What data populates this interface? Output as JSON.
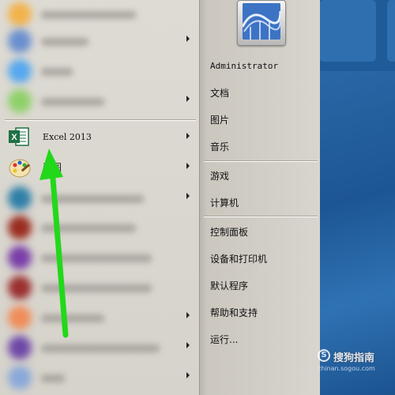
{
  "start_menu": {
    "programs": [
      {
        "label": "",
        "blurred": true,
        "color": "#f2b24a",
        "has_arrow": false
      },
      {
        "label": "",
        "blurred": true,
        "color": "#6a8fcf",
        "has_arrow": true
      },
      {
        "label": "",
        "blurred": true,
        "color": "#56a8f0",
        "has_arrow": false
      },
      {
        "label": "",
        "blurred": true,
        "color": "#8fd068",
        "has_arrow": true
      },
      {
        "label": "Excel 2013",
        "blurred": false,
        "icon": "excel-icon",
        "has_arrow": true
      },
      {
        "label": "画图",
        "blurred": false,
        "icon": "paint-icon",
        "has_arrow": true
      },
      {
        "label": "",
        "blurred": true,
        "color": "#2f7fa8",
        "has_arrow": true
      },
      {
        "label": "",
        "blurred": true,
        "color": "#9a2c20",
        "has_arrow": false
      },
      {
        "label": "",
        "blurred": true,
        "color": "#7a3fa8",
        "has_arrow": false
      },
      {
        "label": "",
        "blurred": true,
        "color": "#9a3030",
        "has_arrow": false
      },
      {
        "label": "",
        "blurred": true,
        "color": "#f08c5a",
        "has_arrow": true
      },
      {
        "label": "",
        "blurred": true,
        "color": "#7048a8",
        "has_arrow": true
      },
      {
        "label": "",
        "blurred": true,
        "color": "#8aa8d8",
        "has_arrow": true
      }
    ],
    "right_items": {
      "user": "Administrator",
      "documents": "文档",
      "pictures": "图片",
      "music": "音乐",
      "games": "游戏",
      "computer": "计算机",
      "control_panel": "控制面板",
      "devices_printers": "设备和打印机",
      "default_programs": "默认程序",
      "help_support": "帮助和支持",
      "run": "运行..."
    }
  },
  "annotation": {
    "arrow_color": "#22d81a"
  },
  "watermark": {
    "main": "搜狗指南",
    "sub": "zhinan.sogou.com"
  }
}
